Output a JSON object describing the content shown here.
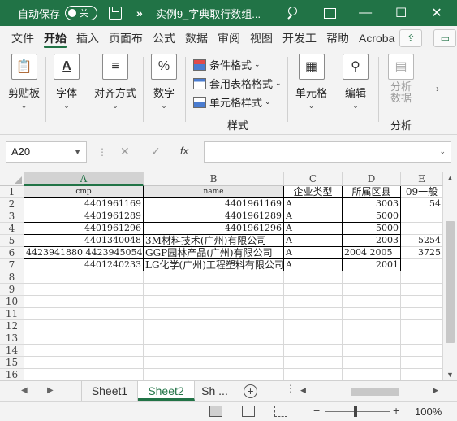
{
  "titlebar": {
    "autosave_label": "自动保存",
    "autosave_state": "关",
    "more": "»",
    "doc_title": "实例9_字典取行数组...",
    "min": "—",
    "max": "☐",
    "close": "✕"
  },
  "ribbon_tabs": [
    "文件",
    "开始",
    "插入",
    "页面布",
    "公式",
    "数据",
    "审阅",
    "视图",
    "开发工",
    "帮助",
    "Acroba"
  ],
  "ribbon": {
    "clipboard": "剪贴板",
    "font": "字体",
    "alignment": "对齐方式",
    "number": "数字",
    "conditional_format": "条件格式",
    "table_format": "套用表格格式",
    "cell_style": "单元格样式",
    "styles_group": "样式",
    "cells": "单元格",
    "editing": "编辑",
    "analyze_data": "分析\n数据",
    "analyze_group": "分析",
    "percent": "%",
    "font_glyph": "A",
    "caret": "⌄"
  },
  "formula_bar": {
    "name_box": "A20",
    "cancel": "✕",
    "enter": "✓",
    "fx": "fx",
    "formula": ""
  },
  "columns": [
    "A",
    "B",
    "C",
    "D",
    "E"
  ],
  "rows": [
    "1",
    "2",
    "3",
    "4",
    "5",
    "6",
    "7",
    "8",
    "9",
    "10",
    "11",
    "12",
    "13",
    "14",
    "15",
    "16"
  ],
  "table": [
    [
      "cmp",
      "name",
      "企业类型",
      "所属区县",
      "09一般"
    ],
    [
      "4401961169",
      "4401961169",
      "A",
      "3003",
      "54"
    ],
    [
      "4401961289",
      "4401961289",
      "A",
      "5000",
      ""
    ],
    [
      "4401961296",
      "4401961296",
      "A",
      "5000",
      ""
    ],
    [
      "4401340048",
      "3M材料技术(广州)有限公司",
      "A",
      "2003",
      "5254"
    ],
    [
      "4423941880  4423945054",
      "GGP园林产品(广州)有限公司",
      "A",
      "2004  2005",
      "3725"
    ],
    [
      "4401240233",
      "LG化学(广州)工程塑料有限公司",
      "A",
      "2001",
      ""
    ]
  ],
  "sheets": [
    "Sheet1",
    "Sheet2",
    "Sh ..."
  ],
  "sheet_add": "+",
  "sheet_more": "⋮",
  "status": {
    "zoom": "100%",
    "minus": "−",
    "plus": "+"
  }
}
